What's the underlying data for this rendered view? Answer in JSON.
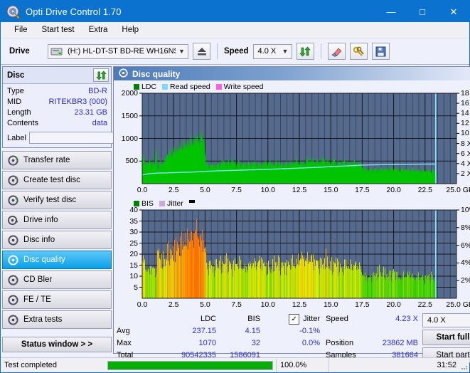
{
  "window": {
    "title": "Opti Drive Control 1.70",
    "icon": "disc-icon",
    "minimize": "—",
    "maximize": "□",
    "close": "✕"
  },
  "menu": {
    "items": [
      "File",
      "Start test",
      "Extra",
      "Help"
    ]
  },
  "toolbar": {
    "drive_label": "Drive",
    "drive_value": "(H:)   HL-DT-ST BD-RE  WH16NS58 TST4",
    "eject_icon": "eject-icon",
    "speed_label": "Speed",
    "speed_value": "4.0 X",
    "refresh_icon": "refresh-icon",
    "erase_icon": "eraser-icon",
    "settings_icon": "keys-icon",
    "save_icon": "floppy-save-icon"
  },
  "disc": {
    "header": "Disc",
    "refresh_icon": "refresh-green-icon",
    "rows": [
      {
        "key": "Type",
        "value": "BD-R"
      },
      {
        "key": "MID",
        "value": "RITEKBR3 (000)"
      },
      {
        "key": "Length",
        "value": "23.31 GB"
      },
      {
        "key": "Contents",
        "value": "data"
      }
    ],
    "label_key": "Label",
    "label_value": "",
    "label_placeholder": "",
    "disc_icon": "cd-icon"
  },
  "nav": {
    "items": [
      {
        "label": "Transfer rate",
        "icon": "disc-test-icon",
        "selected": false
      },
      {
        "label": "Create test disc",
        "icon": "disc-burn-icon",
        "selected": false
      },
      {
        "label": "Verify test disc",
        "icon": "disc-verify-icon",
        "selected": false
      },
      {
        "label": "Drive info",
        "icon": "drive-info-icon",
        "selected": false
      },
      {
        "label": "Disc info",
        "icon": "disc-info-icon",
        "selected": false
      },
      {
        "label": "Disc quality",
        "icon": "disc-quality-icon",
        "selected": true
      },
      {
        "label": "CD Bler",
        "icon": "cd-bler-icon",
        "selected": false
      },
      {
        "label": "FE / TE",
        "icon": "fe-te-icon",
        "selected": false
      },
      {
        "label": "Extra tests",
        "icon": "extra-tests-icon",
        "selected": false
      }
    ],
    "status_window": "Status window > >"
  },
  "panel": {
    "title": "Disc quality",
    "icon": "disc-quality-icon"
  },
  "stats": {
    "col_ldc": "LDC",
    "col_bis": "BIS",
    "jitter_label": "Jitter",
    "jitter_checked": true,
    "rows": [
      {
        "key": "Avg",
        "ldc": "237.15",
        "bis": "4.15",
        "jitter": "-0.1%"
      },
      {
        "key": "Max",
        "ldc": "1070",
        "bis": "32",
        "jitter": "0.0%"
      },
      {
        "key": "Total",
        "ldc": "90542335",
        "bis": "1586091",
        "jitter": ""
      }
    ],
    "speed_key": "Speed",
    "speed_value": "4.23 X",
    "position_key": "Position",
    "position_value": "23862 MB",
    "samples_key": "Samples",
    "samples_value": "381664",
    "speed_select": "4.0 X",
    "start_full": "Start full",
    "start_part": "Start part"
  },
  "statusbar": {
    "message": "Test completed",
    "percent_text": "100.0%",
    "percent": 100,
    "elapsed": "31:52"
  },
  "colors": {
    "titlebar": "#0b72cf",
    "plot_bg": "#566a8e",
    "ldc_green": "#00c400",
    "read_speed": "#7fe3f7",
    "write_speed": "#ff66e0",
    "jitter": "#c8a8d8",
    "progress": "#06ad06",
    "value_blue": "#2b2bd4",
    "selected_nav": "#0a9fe8"
  },
  "chart_data": [
    {
      "type": "area",
      "name": "ldc-chart",
      "title": "",
      "xlabel": "GB",
      "ylabel": "",
      "xlim": [
        0,
        25
      ],
      "ylim": [
        0,
        2000
      ],
      "y2lim": [
        0,
        18
      ],
      "grid": true,
      "legend_position": "top-left",
      "legend": [
        "LDC",
        "Read speed",
        "Write speed"
      ],
      "xticks": [
        "0.0",
        "2.5",
        "5.0",
        "7.5",
        "10.0",
        "12.5",
        "15.0",
        "17.5",
        "20.0",
        "22.5",
        "25.0 GB"
      ],
      "yticks": [
        500,
        1000,
        1500,
        2000
      ],
      "y2ticks": [
        "2 X",
        "4 X",
        "6 X",
        "8 X",
        "10 X",
        "12 X",
        "14 X",
        "16 X",
        "18 X"
      ],
      "data_end_gb": 23.35,
      "cursor_gb": 23.35,
      "series": [
        {
          "name": "LDC",
          "color": "#00c400",
          "kind": "area",
          "x": [
            0.0,
            0.2,
            0.4,
            0.6,
            0.8,
            1.0,
            1.15,
            1.2,
            1.3,
            1.5,
            1.7,
            1.9,
            2.1,
            2.3,
            2.5,
            2.7,
            2.9,
            3.1,
            3.3,
            3.5,
            3.7,
            3.9,
            4.1,
            4.3,
            4.5,
            4.7,
            4.85,
            4.95,
            5.05,
            5.3,
            5.6,
            5.9,
            6.2,
            6.5,
            6.8,
            7.1,
            7.4,
            7.7,
            8.0,
            8.4,
            8.8,
            9.2,
            9.6,
            10.0,
            10.4,
            10.8,
            11.2,
            11.6,
            12.0,
            12.4,
            12.8,
            13.2,
            13.6,
            14.0,
            14.4,
            14.8,
            15.2,
            15.6,
            16.0,
            16.4,
            16.8,
            17.2,
            17.45,
            17.6,
            18.0,
            18.4,
            18.8,
            19.2,
            19.6,
            20.0,
            20.4,
            20.8,
            21.2,
            21.6,
            22.0,
            22.4,
            22.8,
            23.1,
            23.35
          ],
          "y": [
            600,
            470,
            430,
            500,
            440,
            420,
            960,
            300,
            350,
            520,
            420,
            600,
            700,
            640,
            760,
            700,
            820,
            780,
            880,
            840,
            930,
            900,
            980,
            960,
            1010,
            1000,
            1030,
            1010,
            420,
            400,
            420,
            400,
            440,
            500,
            430,
            530,
            420,
            460,
            440,
            420,
            460,
            420,
            440,
            470,
            430,
            460,
            420,
            440,
            460,
            480,
            440,
            520,
            500,
            470,
            540,
            460,
            500,
            450,
            480,
            440,
            470,
            430,
            440,
            330,
            300,
            320,
            300,
            330,
            310,
            340,
            300,
            320,
            290,
            310,
            280,
            300,
            270,
            290,
            280,
            260
          ]
        },
        {
          "name": "Read speed",
          "color": "#7fe3f7",
          "kind": "line",
          "x": [
            0.0,
            0.6,
            1.2,
            2.0,
            3.0,
            4.0,
            5.0,
            6.0,
            7.0,
            8.0,
            9.0,
            10.0,
            11.0,
            12.0,
            13.0,
            14.0,
            15.0,
            16.0,
            17.0,
            17.5,
            19.0,
            21.0,
            23.0,
            23.35
          ],
          "y_x_speed": [
            1.75,
            2.0,
            2.1,
            2.15,
            2.25,
            2.3,
            2.45,
            2.55,
            2.62,
            2.7,
            2.78,
            2.85,
            2.95,
            3.05,
            3.15,
            3.25,
            3.4,
            3.5,
            3.62,
            3.7,
            3.78,
            3.85,
            3.9,
            3.9
          ]
        },
        {
          "name": "Write speed",
          "color": "#ff66e0",
          "kind": "line",
          "x": [],
          "y": []
        }
      ]
    },
    {
      "type": "bar",
      "name": "bis-chart",
      "title": "",
      "xlabel": "GB",
      "ylabel": "",
      "xlim": [
        0,
        25
      ],
      "ylim": [
        0,
        40
      ],
      "y2lim": [
        0,
        10
      ],
      "grid": true,
      "legend_position": "top-left",
      "legend": [
        "BIS",
        "Jitter"
      ],
      "xticks": [
        "0.0",
        "2.5",
        "5.0",
        "7.5",
        "10.0",
        "12.5",
        "15.0",
        "17.5",
        "20.0",
        "22.5",
        "25.0 GB"
      ],
      "yticks": [
        5,
        10,
        15,
        20,
        25,
        30,
        35,
        40
      ],
      "y2ticks": [
        "2%",
        "4%",
        "6%",
        "8%",
        "10%"
      ],
      "data_end_gb": 23.35,
      "cursor_gb": 23.35,
      "series": [
        {
          "name": "BIS",
          "kind": "bars-gradient",
          "low_color": "#00c400",
          "mid_color": "#e8e800",
          "high_color": "#ff7000",
          "x": [
            0.1,
            0.3,
            0.5,
            0.7,
            0.9,
            1.1,
            1.25,
            1.4,
            1.6,
            1.8,
            2.0,
            2.2,
            2.4,
            2.6,
            2.8,
            3.0,
            3.2,
            3.4,
            3.6,
            3.8,
            4.0,
            4.2,
            4.4,
            4.6,
            4.8,
            4.95,
            5.1,
            5.4,
            5.7,
            6.0,
            6.3,
            6.6,
            6.9,
            7.2,
            7.5,
            7.8,
            8.1,
            8.4,
            8.7,
            9.0,
            9.4,
            9.8,
            10.2,
            10.6,
            11.0,
            11.4,
            11.8,
            12.2,
            12.6,
            13.0,
            13.4,
            13.8,
            14.2,
            14.6,
            15.0,
            15.4,
            15.8,
            16.2,
            16.6,
            17.0,
            17.4,
            17.6,
            18.0,
            18.4,
            18.8,
            19.2,
            19.6,
            20.0,
            20.4,
            20.8,
            21.2,
            21.6,
            22.0,
            22.4,
            22.8,
            23.1,
            23.3
          ],
          "y": [
            17,
            13,
            12,
            14,
            13,
            12,
            22,
            18,
            16,
            17,
            20,
            21,
            19,
            24,
            22,
            25,
            23,
            27,
            25,
            29,
            26,
            32,
            28,
            27,
            26,
            25,
            14,
            15,
            13,
            16,
            14,
            17,
            15,
            14,
            16,
            15,
            13,
            14,
            16,
            15,
            17,
            14,
            13,
            16,
            15,
            14,
            16,
            15,
            19,
            17,
            18,
            16,
            15,
            17,
            14,
            16,
            13,
            15,
            14,
            15,
            13,
            10,
            9,
            10,
            12,
            11,
            10,
            12,
            9,
            10,
            11,
            9,
            10,
            9,
            10,
            9,
            9
          ]
        },
        {
          "name": "Jitter",
          "kind": "line",
          "color": "#c8a8d8",
          "x": [],
          "y": []
        }
      ]
    }
  ]
}
